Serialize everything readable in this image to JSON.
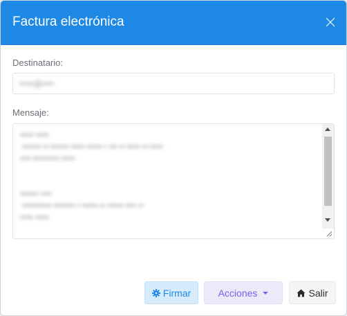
{
  "modal": {
    "title": "Factura electrónica"
  },
  "form": {
    "recipient_label": "Destinatario:",
    "recipient_value": "•••••@••••",
    "message_label": "Mensaje:",
    "message_value": "••••• •••••\n ••••••• •• ••••••• ••••• •••••• • ••• •• ••••• •• •••••\n•••• •••••••••• •••••\n\n\n••••••• ••••\n ••••••••••• •••••••• • •••••• •• •••••• •••• ••\n••••• •••••"
  },
  "footer": {
    "sign_label": "Firmar",
    "actions_label": "Acciones",
    "exit_label": "Salir"
  },
  "icons": {
    "close": "close-icon",
    "sign": "gear-icon",
    "actions": "caret-down-icon",
    "exit": "home-icon"
  },
  "colors": {
    "header": "#1e88e5",
    "sign_button_bg": "#d6ebfb",
    "sign_button_text": "#1e88e5",
    "actions_button_bg": "#ece9f9",
    "actions_button_text": "#7460ee",
    "exit_button_bg": "#f4f5f7"
  }
}
